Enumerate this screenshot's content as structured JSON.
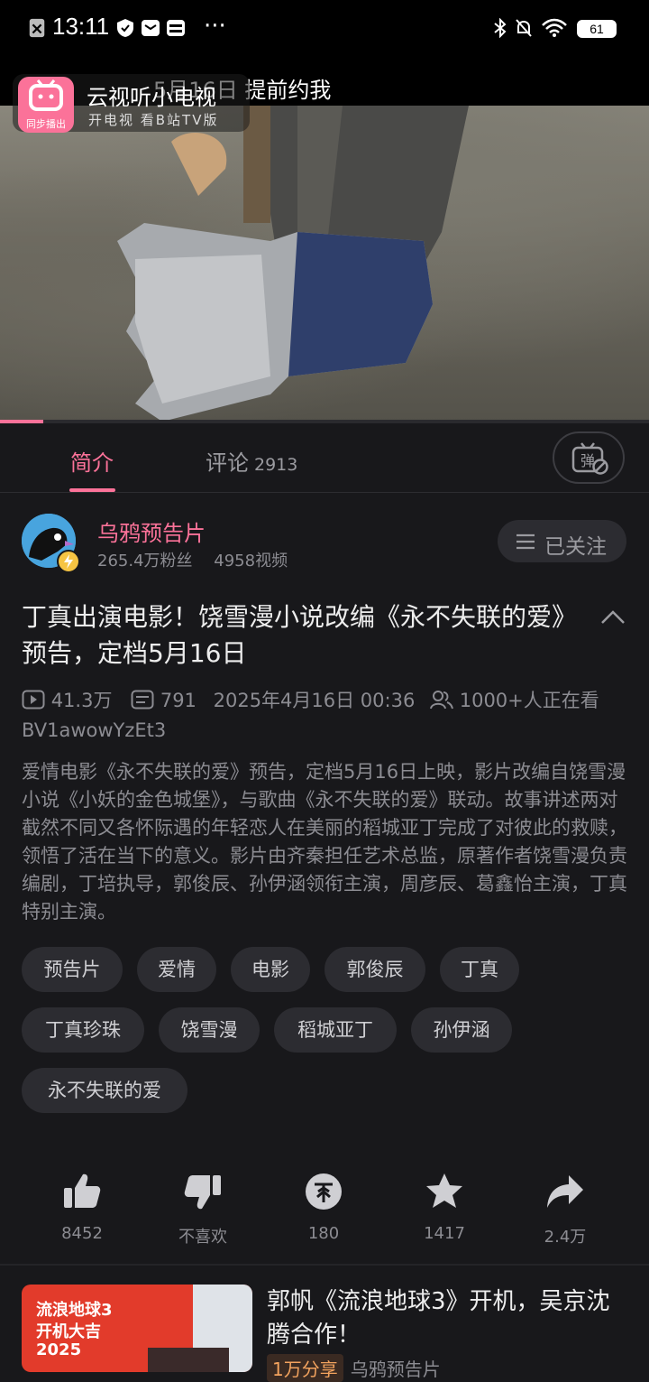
{
  "status_bar": {
    "time": "13:11",
    "battery": "61"
  },
  "video_overlay": {
    "banner_text": "5月16日 提前约我",
    "app_badge": "同步播出",
    "app_title": "云视听小电视",
    "app_subtitle": "开电视 看B站TV版"
  },
  "tabs": {
    "intro_label": "简介",
    "comments_label": "评论",
    "comments_count": "2913",
    "danmaku_icon": "弹"
  },
  "uploader": {
    "name": "乌鸦预告片",
    "fans": "265.4万粉丝",
    "videos": "4958视频",
    "follow_label": "已关注"
  },
  "video": {
    "title": "丁真出演电影！饶雪漫小说改编《永不失联的爱》预告，定档5月16日",
    "views": "41.3万",
    "danmaku_count": "791",
    "publish_time": "2025年4月16日 00:36",
    "watching": "1000+人正在看",
    "bvid": "BV1awowYzEt3",
    "description": "爱情电影《永不失联的爱》预告，定档5月16日上映，影片改编自饶雪漫小说《小妖的金色城堡》，与歌曲《永不失联的爱》联动。故事讲述两对截然不同又各怀际遇的年轻恋人在美丽的稻城亚丁完成了对彼此的救赎，领悟了活在当下的意义。影片由齐秦担任艺术总监，原著作者饶雪漫负责编剧，丁培执导，郭俊辰、孙伊涵领衔主演，周彦辰、葛鑫怡主演，丁真特别主演。"
  },
  "tags": [
    "预告片",
    "爱情",
    "电影",
    "郭俊辰",
    "丁真",
    "丁真珍珠",
    "饶雪漫",
    "稻城亚丁",
    "孙伊涵",
    "永不失联的爱"
  ],
  "actions": {
    "like": "8452",
    "dislike": "不喜欢",
    "coin": "180",
    "favorite": "1417",
    "share": "2.4万"
  },
  "related": {
    "title": "郭帆《流浪地球3》开机，吴京沈腾合作！",
    "badge": "1万分享",
    "author": "乌鸦预告片",
    "thumb_text_1": "流浪地球3",
    "thumb_text_2": "开机大吉",
    "thumb_text_3": "2025"
  },
  "colors": {
    "accent": "#fb7299",
    "background": "#18181b",
    "chip": "#2c2c31"
  }
}
